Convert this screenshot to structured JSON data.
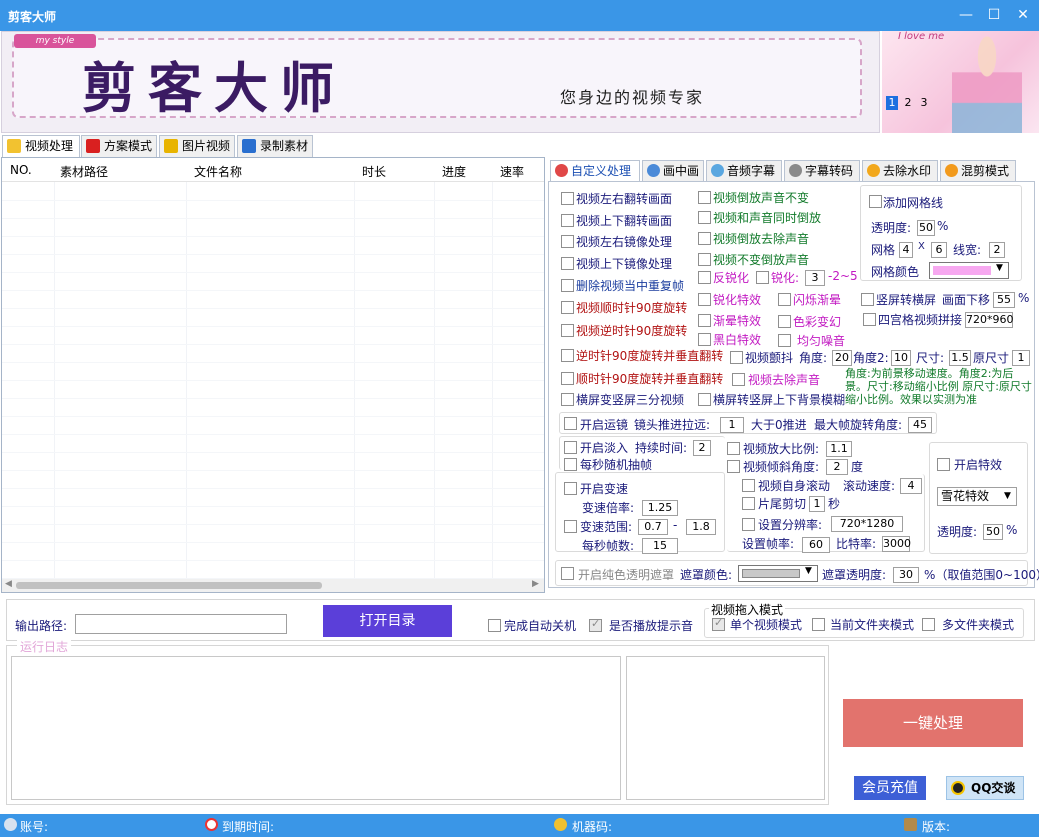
{
  "window": {
    "title": "剪客大师",
    "minimize": "—",
    "maximize": "☐",
    "close": "✕"
  },
  "banner": {
    "logo_text": "剪客大师",
    "slogan": "您身边的视频专家",
    "badge": "my style",
    "art_text": "I love me",
    "pages": [
      "1",
      "2",
      "3"
    ],
    "active_page": 0
  },
  "main_tabs": [
    {
      "label": "视频处理",
      "icon": "folder-icon",
      "selected": true
    },
    {
      "label": "方案模式",
      "icon": "flag-icon",
      "selected": false
    },
    {
      "label": "图片视频",
      "icon": "music-note-icon",
      "selected": false
    },
    {
      "label": "录制素材",
      "icon": "monitor-icon",
      "selected": false
    }
  ],
  "file_list": {
    "columns": [
      "NO.",
      "素材路径",
      "文件名称",
      "时长",
      "进度",
      "速率"
    ],
    "rows": []
  },
  "sub_tabs": [
    {
      "label": "自定义处理",
      "icon": "gear-icon",
      "selected": true
    },
    {
      "label": "画中画",
      "icon": "pip-icon",
      "selected": false
    },
    {
      "label": "音频字幕",
      "icon": "audio-icon",
      "selected": false
    },
    {
      "label": "字幕转码",
      "icon": "subtitle-icon",
      "selected": false
    },
    {
      "label": "去除水印",
      "icon": "sun-icon",
      "selected": false
    },
    {
      "label": "混剪模式",
      "icon": "mix-icon",
      "selected": false
    }
  ],
  "options": {
    "col1": [
      "视频左右翻转画面",
      "视频上下翻转画面",
      "视频左右镜像处理",
      "视频上下镜像处理",
      "删除视频当中重复帧",
      "视频顺时针90度旋转",
      "视频逆时针90度旋转"
    ],
    "col2": [
      "视频倒放声音不变",
      "视频和声音同时倒放",
      "视频倒放去除声音",
      "视频不变倒放声音"
    ],
    "reverse_sharpen": "反锐化",
    "sharpen": "锐化:",
    "sharpen_value": "3",
    "sharpen_range": "-2~5",
    "effects": [
      "锐化特效",
      "闪烁渐晕",
      "渐晕特效",
      "色彩变幻",
      "黑白特效",
      "均匀噪音"
    ],
    "rotate_flip_ccw": "逆时针90度旋转并垂直翻转",
    "rotate_flip_cw": "顺时针90度旋转并垂直翻转",
    "landscape_to_portrait_3": "横屏变竖屏三分视频",
    "landscape_to_portrait_blur": "横屏转竖屏上下背景模糊",
    "shake": "视频颤抖",
    "angle_label": "角度:",
    "angle_value": "20",
    "angle2_label": "角度2:",
    "angle2_value": "10",
    "size_label": "尺寸:",
    "size_value": "1.5",
    "orig_size_label": "原尺寸",
    "orig_size_value": "1",
    "shake_note": "角度:为前景移动速度。角度2:为后景。尺寸:移动缩小比例 原尺寸:原尺寸缩小比例。效果以实测为准",
    "remove_audio": "视频去除声音",
    "grid_panel": {
      "add_grid": "添加网格线",
      "opacity_label": "透明度:",
      "opacity_value": "50",
      "percent": "%",
      "grid_label": "网格",
      "grid_x": "4",
      "x": "X",
      "grid_y": "6",
      "line_width_label": "线宽:",
      "line_width_value": "2",
      "grid_color_label": "网格颜色",
      "grid_color": "#f7a8f0"
    },
    "portrait_to_landscape": "竖屏转横屏",
    "shift_down_label": "画面下移",
    "shift_down_value": "55",
    "nine_grid": "四宫格视频拼接",
    "nine_grid_value": "720*960",
    "zoom_lens": "开启运镜",
    "lens_push_label": "镜头推进拉远:",
    "lens_push_value": "1",
    "lens_note": "大于0推进",
    "max_rotate_label": "最大帧旋转角度:",
    "max_rotate_value": "45",
    "fade_in": "开启淡入",
    "fade_duration_label": "持续时间:",
    "fade_duration_value": "2",
    "random_drop": "每秒随机抽帧",
    "zoom_ratio": "视频放大比例:",
    "zoom_ratio_value": "1.1",
    "tilt_angle": "视频倾斜角度:",
    "tilt_angle_value": "2",
    "degree": "度",
    "self_scroll": "视频自身滚动",
    "scroll_speed_label": "滚动速度:",
    "scroll_speed_value": "4",
    "tail_cut": "片尾剪切",
    "tail_cut_value": "1",
    "second": "秒",
    "set_resolution": "设置分辨率:",
    "resolution_value": "720*1280",
    "frame_rate_label": "设置帧率:",
    "frame_rate_value": "60",
    "bitrate_label": "比特率:",
    "bitrate_value": "3000",
    "speed_change": "开启变速",
    "speed_ratio_label": "变速倍率:",
    "speed_ratio_value": "1.25",
    "speed_range": "变速范围:",
    "speed_min": "0.7",
    "dash": "-",
    "speed_max": "1.8",
    "fps_label": "每秒帧数:",
    "fps_value": "15",
    "effect_enable": "开启特效",
    "effect_select": "雪花特效",
    "effect_opacity_label": "透明度:",
    "effect_opacity_value": "50",
    "mask_enable": "开启纯色透明遮罩",
    "mask_color_label": "遮罩颜色:",
    "mask_color": "#c8c8c8",
    "mask_opacity_label": "遮罩透明度:",
    "mask_opacity_value": "30",
    "mask_note": "%（取值范围0~100）"
  },
  "output": {
    "path_label": "输出路径:",
    "path_value": "",
    "open_dir": "打开目录",
    "auto_shutdown": "完成自动关机",
    "play_prompt": "是否播放提示音",
    "drag_mode_title": "视频拖入模式",
    "drag_modes": [
      "单个视频模式",
      "当前文件夹模式",
      "多文件夹模式"
    ]
  },
  "log": {
    "title": "运行日志"
  },
  "actions": {
    "one_click": "一键处理",
    "vip": "会员充值",
    "qq": "QQ交谈"
  },
  "status": {
    "account": "账号:",
    "expire": "到期时间:",
    "machine": "机器码:",
    "version": "版本:"
  },
  "colors": {
    "title_bar": "#3a96e7",
    "primary_button": "#5b3fd9",
    "process_button": "#e2736d",
    "vip_button": "#3d5fd6"
  }
}
